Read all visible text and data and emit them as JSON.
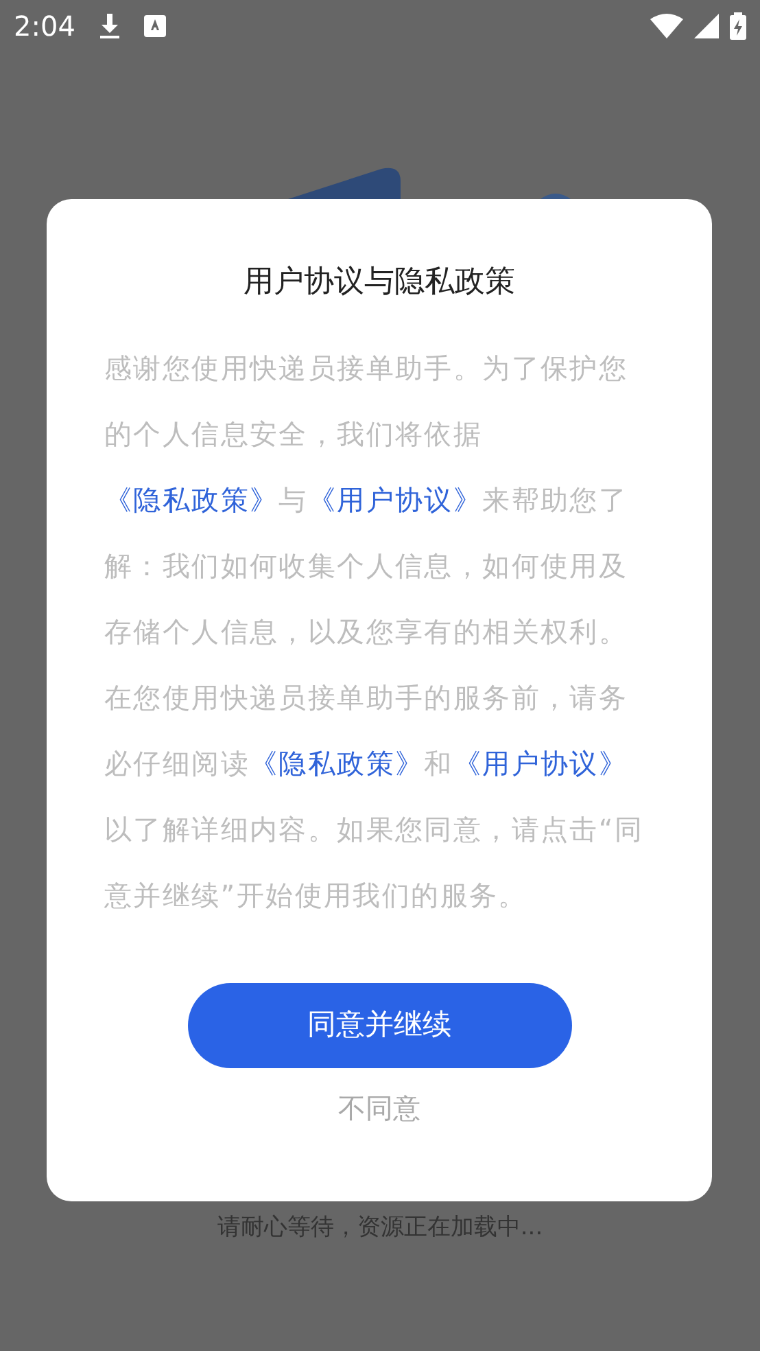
{
  "status_bar": {
    "time": "2:04"
  },
  "dialog": {
    "title": "用户协议与隐私政策",
    "body": [
      {
        "kind": "text",
        "text": "感谢您使用快递员接单助手。为了保护您的个人信息安全，我们将依据"
      },
      {
        "kind": "link",
        "text": "《隐私政策》"
      },
      {
        "kind": "text",
        "text": "与"
      },
      {
        "kind": "link",
        "text": "《用户协议》"
      },
      {
        "kind": "text",
        "text": "来帮助您了解：我们如何收集个人信息，如何使用及存储个人信息，以及您享有的相关权利。在您使用快递员接单助手的服务前，请务必仔细阅读"
      },
      {
        "kind": "link",
        "text": "《隐私政策》"
      },
      {
        "kind": "text",
        "text": "和"
      },
      {
        "kind": "link",
        "text": "《用户协议》"
      },
      {
        "kind": "text",
        "text": "以了解详细内容。如果您同意，请点击“同意并继续”开始使用我们的服务。"
      }
    ],
    "agree_button": "同意并继续",
    "decline_button": "不同意"
  },
  "loading_text": "请耐心等待，资源正在加载中..."
}
